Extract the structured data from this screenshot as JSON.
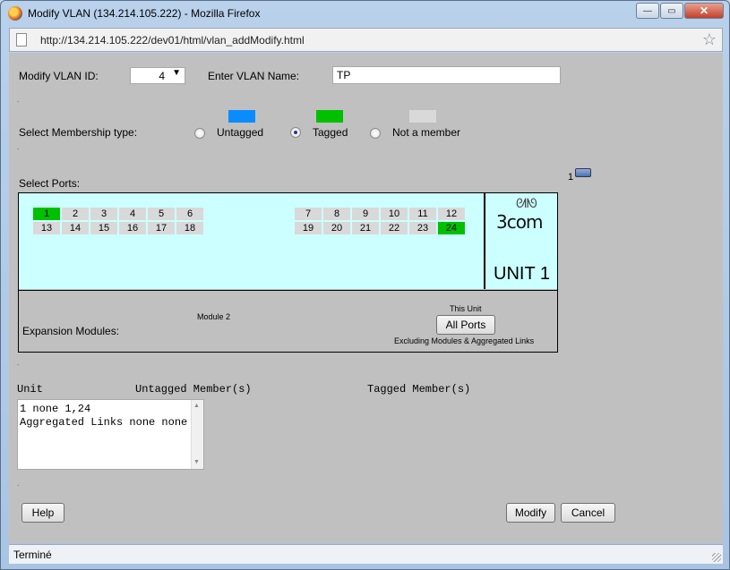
{
  "window": {
    "title": "Modify VLAN (134.214.105.222) - Mozilla Firefox",
    "url": "http://134.214.105.222/dev01/html/vlan_addModify.html",
    "status": "Terminé",
    "controls": {
      "minimize": "—",
      "maximize": "▭",
      "close": "✕"
    }
  },
  "form": {
    "vlan_id_label": "Modify VLAN ID:",
    "vlan_id_value": "4",
    "vlan_name_label": "Enter VLAN Name:",
    "vlan_name_value": "TP",
    "membership_label": "Select Membership type:",
    "membership_types": [
      {
        "label": "Untagged",
        "color": "#0a8cff",
        "checked": false
      },
      {
        "label": "Tagged",
        "color": "#00c000",
        "checked": true
      },
      {
        "label": "Not a member",
        "color": "#d9d9d9",
        "checked": false
      }
    ],
    "select_ports_label": "Select Ports:",
    "unit_marker": "1"
  },
  "ports": {
    "row1": [
      "1",
      "2",
      "3",
      "4",
      "5",
      "6",
      "7",
      "8",
      "9",
      "10",
      "11",
      "12"
    ],
    "row2": [
      "13",
      "14",
      "15",
      "16",
      "17",
      "18",
      "19",
      "20",
      "21",
      "22",
      "23",
      "24"
    ],
    "tagged": [
      "1",
      "24"
    ],
    "tagged_color": "#00c000",
    "empty_color": "#d9d9d9",
    "area_color": "#ccffff"
  },
  "unit": {
    "logo_text": "3com",
    "label": "UNIT 1"
  },
  "expansion": {
    "label": "Expansion Modules:",
    "module_label": "Module 2",
    "this_unit_label": "This Unit",
    "all_ports_button": "All Ports",
    "excluding_note": "Excluding Modules & Aggregated Links"
  },
  "members": {
    "header_unit": "Unit",
    "header_untagged": "Untagged Member(s)",
    "header_tagged": "Tagged Member(s)",
    "lines": [
      "1 none 1,24",
      "Aggregated Links none none"
    ]
  },
  "buttons": {
    "help": "Help",
    "modify": "Modify",
    "cancel": "Cancel"
  }
}
